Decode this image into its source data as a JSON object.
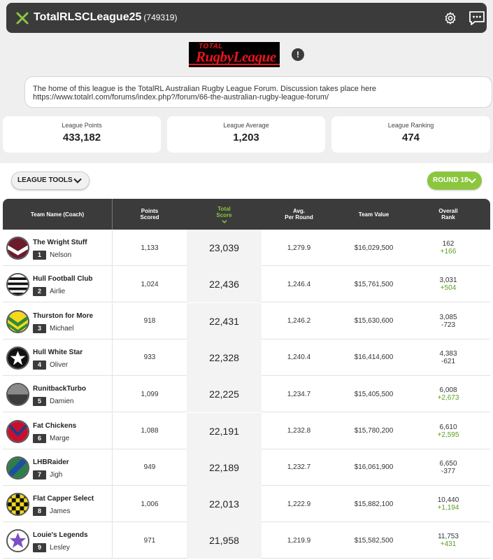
{
  "header": {
    "title": "TotalRLSCLeague25",
    "league_id": "(749319)"
  },
  "logo": {
    "line1": "TOTAL",
    "line2": "RugbyLeague"
  },
  "description": "The home of this league is the TotalRL Australian Rugby League Forum. Discussion takes place here https://www.totalrl.com/forums/index.php?/forum/66-the-australian-rugby-league-forum/",
  "stats": [
    {
      "label": "League Points",
      "value": "433,182"
    },
    {
      "label": "League Average",
      "value": "1,203"
    },
    {
      "label": "League Ranking",
      "value": "474"
    }
  ],
  "tools_label": "LEAGUE TOOLS",
  "round_label": "ROUND 18",
  "colors": {
    "accent": "#8cc63f",
    "dark": "#3b3b3b",
    "up": "#5a9e1f"
  },
  "table": {
    "headers": {
      "team": "Team Name (Coach)",
      "points_1": "Points",
      "points_2": "Scored",
      "total_1": "Total",
      "total_2": "Score",
      "avg_1": "Avg.",
      "avg_2": "Per Round",
      "value": "Team Value",
      "overall_1": "Overall",
      "overall_2": "Rank"
    },
    "rows": [
      {
        "team": "The Wright Stuff",
        "rank": "1",
        "coach": "Nelson",
        "points": "1,133",
        "total": "23,039",
        "avg": "1,279.9",
        "value": "$16,029,500",
        "overall": "162",
        "move": "+166",
        "dir": "up",
        "jersey": "chevron-maroon"
      },
      {
        "team": "Hull Football Club",
        "rank": "2",
        "coach": "Airlie",
        "points": "1,024",
        "total": "22,436",
        "avg": "1,246.4",
        "value": "$15,761,500",
        "overall": "3,031",
        "move": "+504",
        "dir": "up",
        "jersey": "hoops-black-white"
      },
      {
        "team": "Thurston for More",
        "rank": "3",
        "coach": "Michael",
        "points": "918",
        "total": "22,431",
        "avg": "1,246.2",
        "value": "$15,630,600",
        "overall": "3,085",
        "move": "-723",
        "dir": "down",
        "jersey": "chevron-yellow-green"
      },
      {
        "team": "Hull White Star",
        "rank": "4",
        "coach": "Oliver",
        "points": "933",
        "total": "22,328",
        "avg": "1,240.4",
        "value": "$16,414,600",
        "overall": "4,383",
        "move": "-621",
        "dir": "down",
        "jersey": "star-black-white"
      },
      {
        "team": "RunitbackTurbo",
        "rank": "5",
        "coach": "Damien",
        "points": "1,099",
        "total": "22,225",
        "avg": "1,234.7",
        "value": "$15,405,500",
        "overall": "6,008",
        "move": "+2,673",
        "dir": "up",
        "jersey": "half-grey"
      },
      {
        "team": "Fat Chickens",
        "rank": "6",
        "coach": "Marge",
        "points": "1,088",
        "total": "22,191",
        "avg": "1,232.8",
        "value": "$15,780,200",
        "overall": "6,610",
        "move": "+2,595",
        "dir": "up",
        "jersey": "vee-red-blue"
      },
      {
        "team": "LHBRaider",
        "rank": "7",
        "coach": "Jigh",
        "points": "949",
        "total": "22,189",
        "avg": "1,232.7",
        "value": "$16,061,900",
        "overall": "6,650",
        "move": "-377",
        "dir": "down",
        "jersey": "sash-green"
      },
      {
        "team": "Flat Capper Select",
        "rank": "8",
        "coach": "James",
        "points": "1,006",
        "total": "22,013",
        "avg": "1,222.9",
        "value": "$15,882,100",
        "overall": "10,440",
        "move": "+1,194",
        "dir": "up",
        "jersey": "checker-yellow-black"
      },
      {
        "team": "Louie's Legends",
        "rank": "9",
        "coach": "Lesley",
        "points": "971",
        "total": "21,958",
        "avg": "1,219.9",
        "value": "$15,582,500",
        "overall": "11,753",
        "move": "+431",
        "dir": "up",
        "jersey": "star-purple"
      }
    ]
  }
}
